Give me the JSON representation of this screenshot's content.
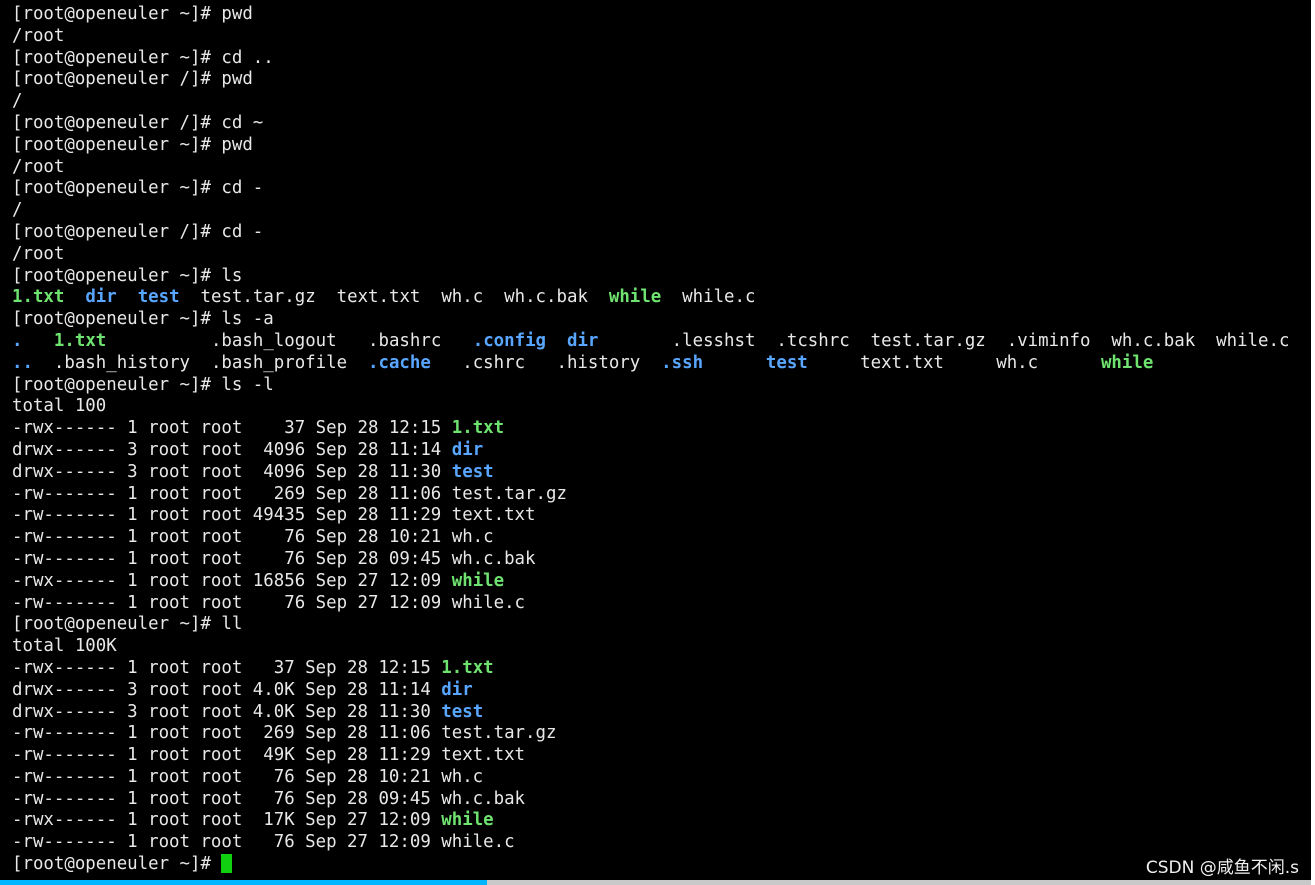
{
  "watermark": "CSDN @咸鱼不闲.s",
  "colors": {
    "background": "#000000",
    "text": "#e8e8e8",
    "directory": "#58a6ff",
    "executable": "#6fe36f",
    "cursor": "#10d010",
    "scroll_thumb": "#00b7ff"
  },
  "terminal": {
    "lines": [
      [
        {
          "text": "[root@openeuler ~]# pwd",
          "style": "plain"
        }
      ],
      [
        {
          "text": "/root",
          "style": "plain"
        }
      ],
      [
        {
          "text": "[root@openeuler ~]# cd ..",
          "style": "plain"
        }
      ],
      [
        {
          "text": "[root@openeuler /]# pwd",
          "style": "plain"
        }
      ],
      [
        {
          "text": "/",
          "style": "plain"
        }
      ],
      [
        {
          "text": "[root@openeuler /]# cd ~",
          "style": "plain"
        }
      ],
      [
        {
          "text": "[root@openeuler ~]# pwd",
          "style": "plain"
        }
      ],
      [
        {
          "text": "/root",
          "style": "plain"
        }
      ],
      [
        {
          "text": "[root@openeuler ~]# cd -",
          "style": "plain"
        }
      ],
      [
        {
          "text": "/",
          "style": "plain"
        }
      ],
      [
        {
          "text": "[root@openeuler /]# cd -",
          "style": "plain"
        }
      ],
      [
        {
          "text": "/root",
          "style": "plain"
        }
      ],
      [
        {
          "text": "[root@openeuler ~]# ls",
          "style": "plain"
        }
      ],
      [
        {
          "text": "1.txt",
          "style": "exe"
        },
        {
          "text": "  ",
          "style": "plain"
        },
        {
          "text": "dir",
          "style": "dir"
        },
        {
          "text": "  ",
          "style": "plain"
        },
        {
          "text": "test",
          "style": "dir"
        },
        {
          "text": "  test.tar.gz  text.txt  wh.c  wh.c.bak  ",
          "style": "plain"
        },
        {
          "text": "while",
          "style": "exe"
        },
        {
          "text": "  while.c",
          "style": "plain"
        }
      ],
      [
        {
          "text": "[root@openeuler ~]# ls -a",
          "style": "plain"
        }
      ],
      [
        {
          "text": ".",
          "style": "dir"
        },
        {
          "text": "   ",
          "style": "plain"
        },
        {
          "text": "1.txt",
          "style": "exe"
        },
        {
          "text": "          .bash_logout   .bashrc   ",
          "style": "plain"
        },
        {
          "text": ".config",
          "style": "dir"
        },
        {
          "text": "  ",
          "style": "plain"
        },
        {
          "text": "dir",
          "style": "dir"
        },
        {
          "text": "       .lesshst  .tcshrc  test.tar.gz  .viminfo  wh.c.bak  while.c",
          "style": "plain"
        }
      ],
      [
        {
          "text": "..",
          "style": "dir"
        },
        {
          "text": "  .bash_history  .bash_profile  ",
          "style": "plain"
        },
        {
          "text": ".cache",
          "style": "dir"
        },
        {
          "text": "   .cshrc   .history  ",
          "style": "plain"
        },
        {
          "text": ".ssh",
          "style": "dir"
        },
        {
          "text": "      ",
          "style": "plain"
        },
        {
          "text": "test",
          "style": "dir"
        },
        {
          "text": "     text.txt     wh.c      ",
          "style": "plain"
        },
        {
          "text": "while",
          "style": "exe"
        }
      ],
      [
        {
          "text": "[root@openeuler ~]# ls -l",
          "style": "plain"
        }
      ],
      [
        {
          "text": "total 100",
          "style": "plain"
        }
      ],
      [
        {
          "text": "-rwx------ 1 root root    37 Sep 28 12:15 ",
          "style": "plain"
        },
        {
          "text": "1.txt",
          "style": "exe"
        }
      ],
      [
        {
          "text": "drwx------ 3 root root  4096 Sep 28 11:14 ",
          "style": "plain"
        },
        {
          "text": "dir",
          "style": "dir"
        }
      ],
      [
        {
          "text": "drwx------ 3 root root  4096 Sep 28 11:30 ",
          "style": "plain"
        },
        {
          "text": "test",
          "style": "dir"
        }
      ],
      [
        {
          "text": "-rw------- 1 root root   269 Sep 28 11:06 test.tar.gz",
          "style": "plain"
        }
      ],
      [
        {
          "text": "-rw------- 1 root root 49435 Sep 28 11:29 text.txt",
          "style": "plain"
        }
      ],
      [
        {
          "text": "-rw------- 1 root root    76 Sep 28 10:21 wh.c",
          "style": "plain"
        }
      ],
      [
        {
          "text": "-rw------- 1 root root    76 Sep 28 09:45 wh.c.bak",
          "style": "plain"
        }
      ],
      [
        {
          "text": "-rwx------ 1 root root 16856 Sep 27 12:09 ",
          "style": "plain"
        },
        {
          "text": "while",
          "style": "exe"
        }
      ],
      [
        {
          "text": "-rw------- 1 root root    76 Sep 27 12:09 while.c",
          "style": "plain"
        }
      ],
      [
        {
          "text": "[root@openeuler ~]# ll",
          "style": "plain"
        }
      ],
      [
        {
          "text": "total 100K",
          "style": "plain"
        }
      ],
      [
        {
          "text": "-rwx------ 1 root root   37 Sep 28 12:15 ",
          "style": "plain"
        },
        {
          "text": "1.txt",
          "style": "exe"
        }
      ],
      [
        {
          "text": "drwx------ 3 root root 4.0K Sep 28 11:14 ",
          "style": "plain"
        },
        {
          "text": "dir",
          "style": "dir"
        }
      ],
      [
        {
          "text": "drwx------ 3 root root 4.0K Sep 28 11:30 ",
          "style": "plain"
        },
        {
          "text": "test",
          "style": "dir"
        }
      ],
      [
        {
          "text": "-rw------- 1 root root  269 Sep 28 11:06 test.tar.gz",
          "style": "plain"
        }
      ],
      [
        {
          "text": "-rw------- 1 root root  49K Sep 28 11:29 text.txt",
          "style": "plain"
        }
      ],
      [
        {
          "text": "-rw------- 1 root root   76 Sep 28 10:21 wh.c",
          "style": "plain"
        }
      ],
      [
        {
          "text": "-rw------- 1 root root   76 Sep 28 09:45 wh.c.bak",
          "style": "plain"
        }
      ],
      [
        {
          "text": "-rwx------ 1 root root  17K Sep 27 12:09 ",
          "style": "plain"
        },
        {
          "text": "while",
          "style": "exe"
        }
      ],
      [
        {
          "text": "-rw------- 1 root root   76 Sep 27 12:09 while.c",
          "style": "plain"
        }
      ]
    ],
    "prompt": "[root@openeuler ~]# "
  }
}
